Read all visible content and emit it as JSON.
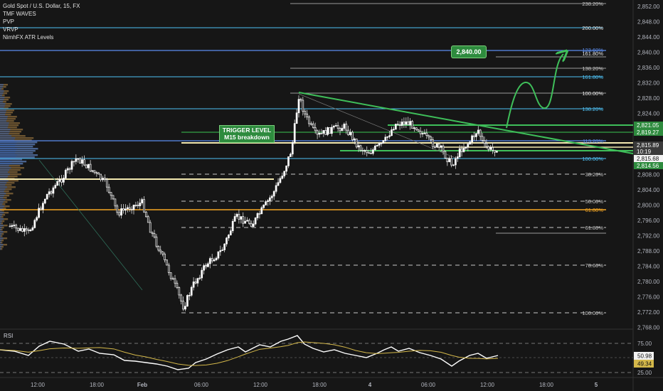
{
  "symbol": {
    "title": "Gold Spot / U.S. Dollar, 15, FX",
    "indicators": [
      "TMF WAVES",
      "PVP",
      "VRVP",
      "NimhFX ATR Levels"
    ]
  },
  "callouts": {
    "trigger_line1": "TRIGGER LEVEL",
    "trigger_line2": "M15 breakdown",
    "target": "2,840.00"
  },
  "rsi": {
    "label": "RSI",
    "value_white": "50.98",
    "value_yellow": "49.34",
    "ticks": [
      "75.00",
      "25.00"
    ]
  },
  "price_axis": {
    "ticks": [
      "2,852.00",
      "2,848.00",
      "2,844.00",
      "2,840.00",
      "2,836.00",
      "2,832.00",
      "2,828.00",
      "2,824.00",
      "2,820.00",
      "2,816.00",
      "2,812.00",
      "2,808.00",
      "2,804.00",
      "2,800.00",
      "2,796.00",
      "2,792.00",
      "2,788.00",
      "2,784.00",
      "2,780.00",
      "2,776.00",
      "2,772.00",
      "2,768.00"
    ],
    "labels": [
      {
        "text": "2,821.05",
        "color": "#2e8b3e"
      },
      {
        "text": "2,819.27",
        "color": "#2e8b3e"
      },
      {
        "text": "2,815.89",
        "color": "#3a3a3a"
      },
      {
        "text": "10:19",
        "color": "#3a3a3a"
      },
      {
        "text": "2,815.68",
        "color": "#f2f2f2"
      },
      {
        "text": "2,814.56",
        "color": "#2e8b3e"
      }
    ]
  },
  "time_axis": {
    "labels": [
      "12:00",
      "18:00",
      "Feb",
      "06:00",
      "12:00",
      "18:00",
      "4",
      "06:00",
      "12:00",
      "18:00",
      "5"
    ]
  },
  "fib_labels": [
    "238.20%",
    "200.00%",
    "161.80%",
    "123.60%",
    "138.20%",
    "100.00%",
    "161.80%",
    "138.20%",
    "113.20%",
    "100.00%",
    "38.20%",
    "50.00%",
    "61.80%",
    "61.80%",
    "78.60%",
    "100.00%"
  ],
  "colors": {
    "background": "#161616",
    "bull": "#ffffff",
    "bear": "#ffffff",
    "trigger": "#2e8b3e",
    "orange": "#f5a623",
    "cream": "#f3e9b0",
    "cyan": "#4fc3f7",
    "blue": "#5b8def"
  }
}
